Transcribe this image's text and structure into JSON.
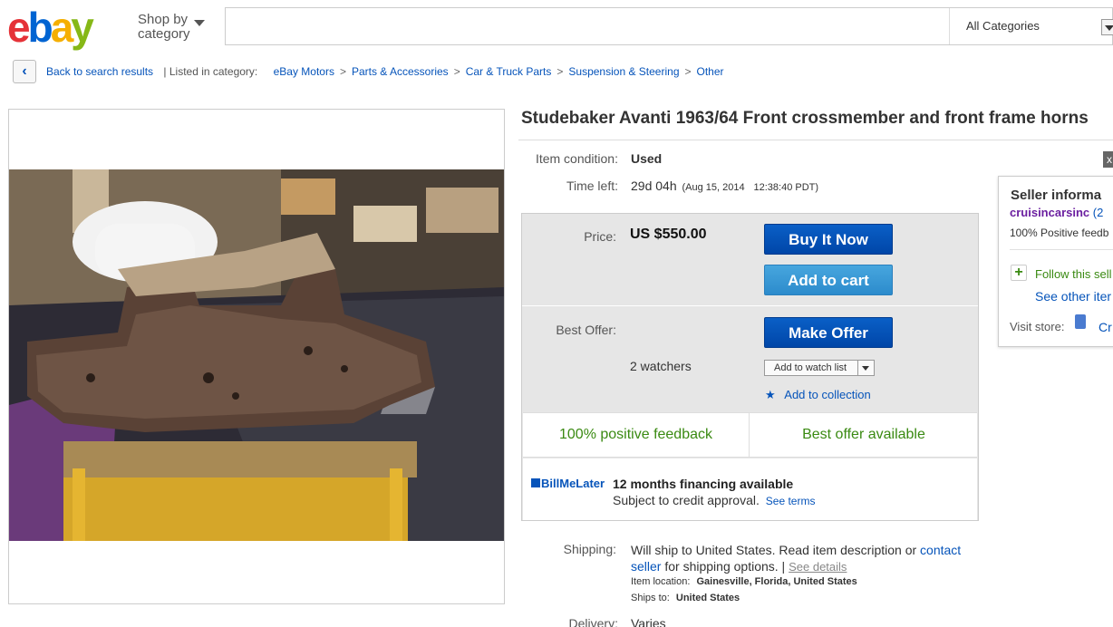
{
  "header": {
    "logo": {
      "e": "e",
      "b": "b",
      "a": "a",
      "y": "y"
    },
    "shop_by": "Shop by",
    "category": "category",
    "search_placeholder": "",
    "category_select": "All Categories"
  },
  "breadcrumb": {
    "back": "Back to search results",
    "listed_in": "| Listed in category:",
    "items": [
      "eBay Motors",
      "Parts & Accessories",
      "Car & Truck Parts",
      "Suspension & Steering",
      "Other"
    ],
    "separator": ">"
  },
  "item": {
    "title": "Studebaker Avanti 1963/64 Front crossmember and front frame horns",
    "condition_label": "Item condition:",
    "condition_value": "Used",
    "time_left_label": "Time left:",
    "time_left_value": "29d 04h",
    "time_left_end": "(Aug 15, 2014",
    "time_left_clock": "12:38:40 PDT)"
  },
  "pricing": {
    "price_label": "Price:",
    "price_value": "US $550.00",
    "buy_now": "Buy It Now",
    "add_to_cart": "Add to cart",
    "best_offer_label": "Best Offer:",
    "make_offer": "Make Offer",
    "watchers": "2 watchers",
    "add_to_watch": "Add to watch list",
    "add_to_collection": "Add to collection",
    "positive_feedback": "100% positive feedback",
    "best_offer_available": "Best offer available",
    "billmelater_bill": "Bill",
    "billmelater_me": "Me",
    "billmelater_later": "Later",
    "financing": "12 months financing available",
    "credit": "Subject to credit approval.",
    "see_terms": "See terms"
  },
  "shipping": {
    "label": "Shipping:",
    "text1": "Will ship to United States. Read item description or",
    "contact": "contact",
    "seller": "seller",
    "text2": "for shipping options. |",
    "see_details": "See details",
    "location_label": "Item location:",
    "location_value": "Gainesville, Florida, United States",
    "ships_to_label": "Ships to:",
    "ships_to_value": "United States",
    "delivery_label": "Delivery:",
    "delivery_value": "Varies"
  },
  "seller_panel": {
    "heading": "Seller informa",
    "name": "cruisincarsinc",
    "score": "(2",
    "positive": "100% Positive feedb",
    "follow": "Follow this sell",
    "see_other": "See other iter",
    "visit_store": "Visit store:",
    "store_link": "Cr",
    "close": "x"
  },
  "colors": {
    "link": "#0654ba",
    "buy_now": "#0052b4",
    "add_to_cart": "#3a9ad9",
    "positive_green": "#3a8a12",
    "seller_name": "#6b1fa0"
  }
}
